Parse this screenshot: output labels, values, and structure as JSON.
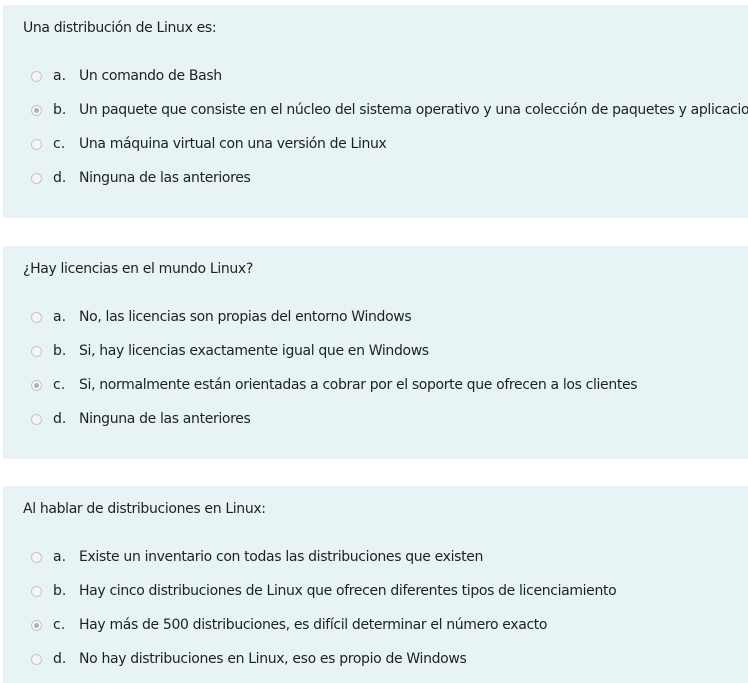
{
  "questions": [
    {
      "text": "Una distribución de Linux es:",
      "answers": [
        {
          "letter": "a.",
          "text": "Un comando de Bash",
          "selected": false
        },
        {
          "letter": "b.",
          "text": "Un paquete que consiste en el núcleo del sistema operativo y una colección de paquetes y aplicaciones",
          "selected": true
        },
        {
          "letter": "c.",
          "text": "Una máquina virtual con una versión de Linux",
          "selected": false
        },
        {
          "letter": "d.",
          "text": "Ninguna de las anteriores",
          "selected": false
        }
      ]
    },
    {
      "text": "¿Hay licencias en el mundo Linux?",
      "answers": [
        {
          "letter": "a.",
          "text": "No, las licencias son propias del entorno Windows",
          "selected": false
        },
        {
          "letter": "b.",
          "text": "Si, hay licencias exactamente igual que en Windows",
          "selected": false
        },
        {
          "letter": "c.",
          "text": "Si, normalmente están orientadas a cobrar por el soporte que ofrecen a los clientes",
          "selected": true
        },
        {
          "letter": "d.",
          "text": "Ninguna de las anteriores",
          "selected": false
        }
      ]
    },
    {
      "text": "Al hablar de distribuciones en Linux:",
      "answers": [
        {
          "letter": "a.",
          "text": "Existe un inventario con todas las distribuciones que existen",
          "selected": false
        },
        {
          "letter": "b.",
          "text": "Hay cinco distribuciones de Linux que ofrecen diferentes tipos de licenciamiento",
          "selected": false
        },
        {
          "letter": "c.",
          "text": "Hay más de 500 distribuciones, es difícil determinar el número exacto",
          "selected": true
        },
        {
          "letter": "d.",
          "text": "No hay distribuciones en Linux, eso es propio de Windows",
          "selected": false
        }
      ]
    }
  ]
}
